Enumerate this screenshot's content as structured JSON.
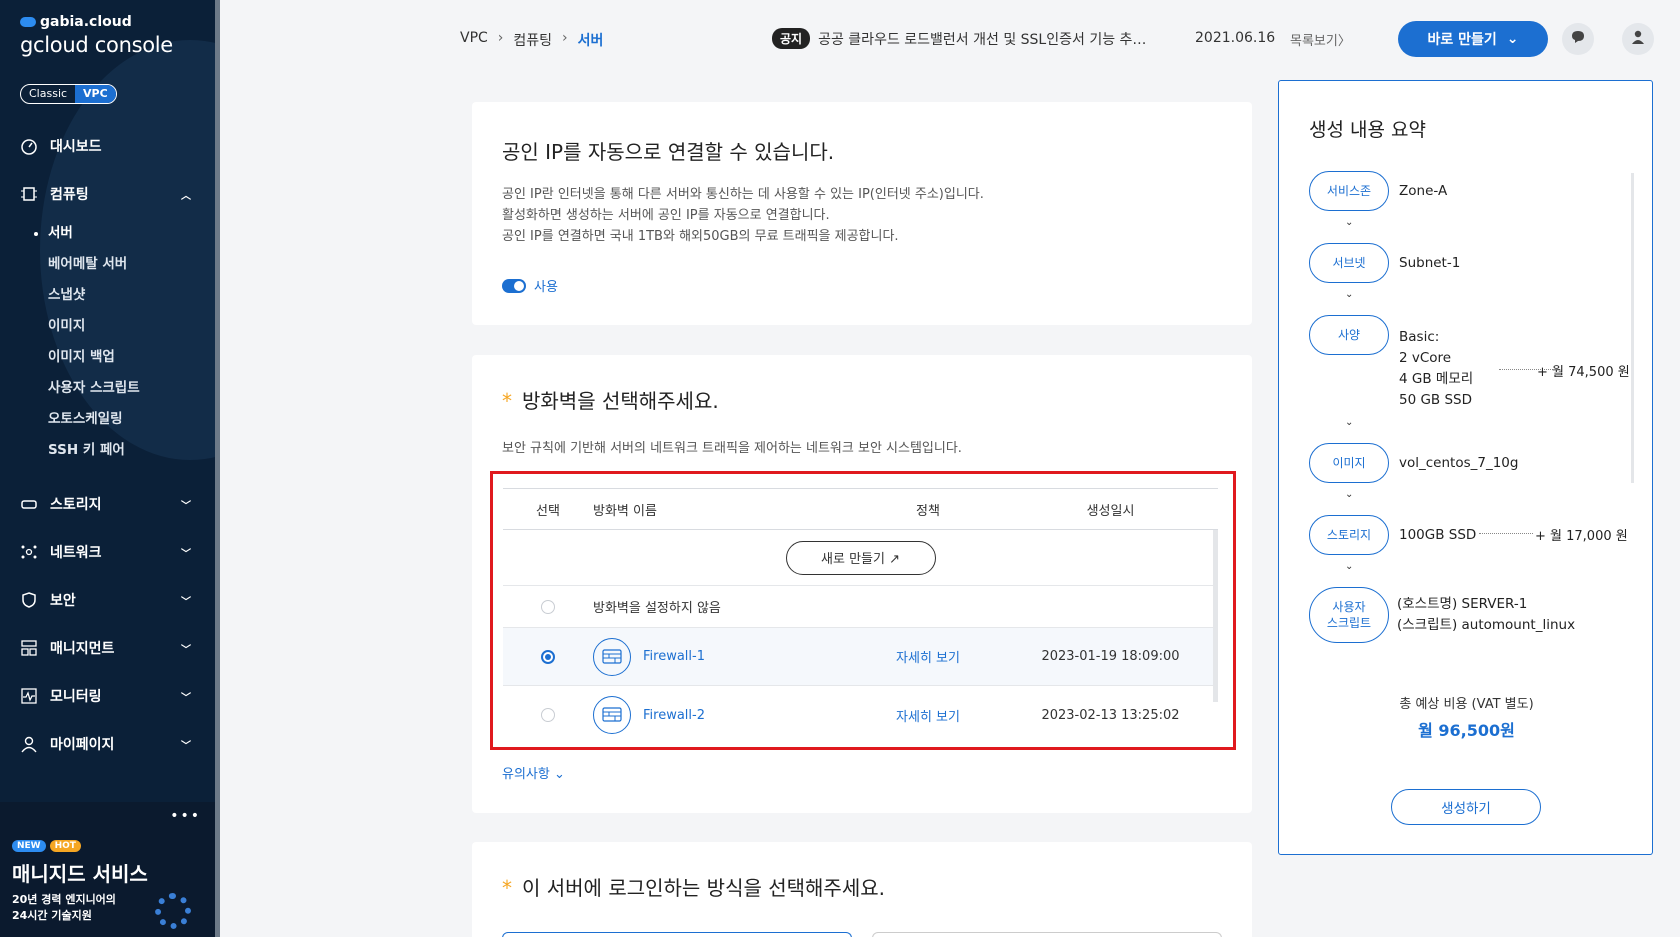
{
  "brand": {
    "top": "gabia.cloud",
    "main": "gcloud console"
  },
  "mode_toggle": {
    "classic": "Classic",
    "vpc": "VPC"
  },
  "nav": {
    "dashboard": "대시보드",
    "computing": "컴퓨팅",
    "computing_sub": [
      "서버",
      "베어메탈 서버",
      "스냅샷",
      "이미지",
      "이미지 백업",
      "사용자 스크립트",
      "오토스케일링",
      "SSH 키 페어"
    ],
    "storage": "스토리지",
    "network": "네트워크",
    "security": "보안",
    "management": "매니지먼트",
    "monitoring": "모니터링",
    "mypage": "마이페이지"
  },
  "promo": {
    "dots": "•••",
    "badge_new": "NEW",
    "badge_hot": "HOT",
    "title": "매니지드 서비스",
    "line1": "20년 경력 엔지니어의",
    "line2": "24시간 기술지원"
  },
  "breadcrumb": {
    "a": "VPC",
    "b": "컴퓨팅",
    "c": "서버",
    "sep": "›"
  },
  "notice": {
    "tag": "공지",
    "text": "공공 클라우드 로드밸런서 개선 및 SSL인증서 기능 추가 안내",
    "date": "2021.06.16",
    "more": "목록보기〉"
  },
  "header": {
    "create_label": "바로 만들기",
    "chevron": "⌄"
  },
  "public_ip": {
    "title": "공인 IP를 자동으로 연결할 수 있습니다.",
    "desc1": "공인 IP란 인터넷을 통해 다른 서버와 통신하는 데 사용할 수 있는 IP(인터넷 주소)입니다.",
    "desc2": "활성화하면 생성하는 서버에 공인 IP를 자동으로 연결합니다.",
    "desc3": "공인 IP를 연결하면 국내 1TB와 해외50GB의 무료 트래픽을 제공합니다.",
    "switch_label": "사용",
    "enabled": true
  },
  "firewall": {
    "required_mark": "*",
    "title": "방화벽을 선택해주세요.",
    "desc": "보안 규칙에 기반해 서버의 네트워크 트래픽을 제어하는 네트워크 보안 시스템입니다.",
    "headers": {
      "select": "선택",
      "name": "방화벽 이름",
      "policy": "정책",
      "created": "생성일시"
    },
    "new_button": "새로 만들기 ↗",
    "none_label": "방화벽을 설정하지 않음",
    "rows": [
      {
        "name": "Firewall-1",
        "policy": "자세히 보기",
        "created": "2023-01-19 18:09:00",
        "selected": true
      },
      {
        "name": "Firewall-2",
        "policy": "자세히 보기",
        "created": "2023-02-13 13:25:02",
        "selected": false
      }
    ],
    "notes": "유의사항 ⌄"
  },
  "login": {
    "required_mark": "*",
    "title": "이 서버에 로그인하는 방식을 선택해주세요."
  },
  "summary": {
    "title": "생성 내용 요약",
    "zone": {
      "label": "서비스존",
      "value": "Zone-A"
    },
    "subnet": {
      "label": "서브넷",
      "value": "Subnet-1"
    },
    "spec": {
      "label": "사양",
      "l1": "Basic:",
      "l2": "2 vCore",
      "l3": "4 GB 메모리",
      "l4": "50 GB SSD",
      "price": "+ 월 74,500 원"
    },
    "image": {
      "label": "이미지",
      "value": "vol_centos_7_10g"
    },
    "storage": {
      "label": "스토리지",
      "value": "100GB SSD",
      "price": "+ 월 17,000 원"
    },
    "script": {
      "label1": "사용자",
      "label2": "스크립트",
      "l1": "(호스트명) SERVER-1",
      "l2": "(스크립트) automount_linux"
    },
    "arrow": "⌄",
    "total_label": "총 예상 비용 (VAT 별도)",
    "total_value": "월 96,500원",
    "generate": "생성하기"
  }
}
